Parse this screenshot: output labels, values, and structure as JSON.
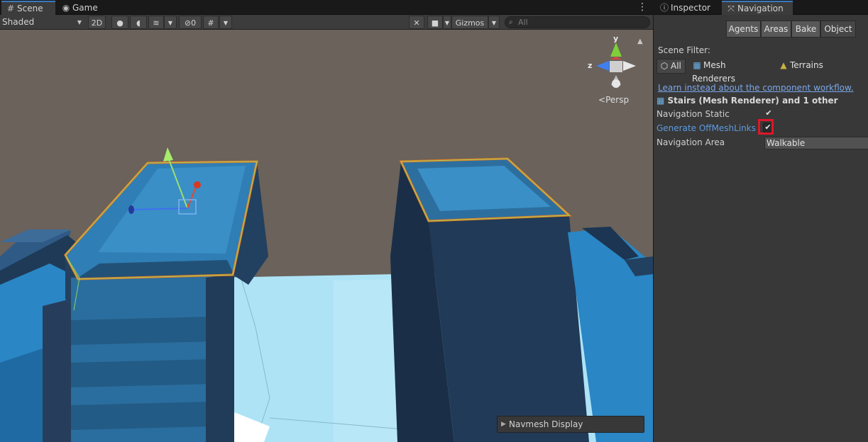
{
  "scene_window": {
    "tabs": [
      {
        "label": "Scene",
        "icon": "hash-grid-icon"
      },
      {
        "label": "Game",
        "icon": "gamepad-icon"
      }
    ],
    "toolbar": {
      "shading_mode": "Shaded",
      "toggle_2d": "2D",
      "hidden_count": "0",
      "gizmos_label": "Gizmos",
      "search_placeholder": "All"
    },
    "orientation_gizmo": {
      "y_label": "y",
      "z_label": "z",
      "projection": "Persp"
    },
    "overlay": {
      "navmesh_display": "Navmesh Display"
    }
  },
  "nav_window": {
    "tabs": [
      {
        "label": "Inspector",
        "icon": "info-icon"
      },
      {
        "label": "Navigation",
        "icon": "navigation-icon"
      }
    ],
    "modes": [
      "Agents",
      "Areas",
      "Bake",
      "Object"
    ],
    "selected_mode": "Object",
    "scene_filter": {
      "label": "Scene Filter:",
      "options": [
        "All",
        "Mesh Renderers",
        "Terrains"
      ],
      "selected": "All"
    },
    "workflow_link": "Learn instead about the component workflow.",
    "object_title": "Stairs (Mesh Renderer) and 1 other",
    "fields": {
      "navigation_static": {
        "label": "Navigation Static",
        "checked": true
      },
      "generate_offmeshlinks": {
        "label": "Generate OffMeshLinks",
        "checked": true
      },
      "navigation_area": {
        "label": "Navigation Area",
        "value": "Walkable"
      }
    }
  },
  "colors": {
    "accent_tab": "#3a79bb",
    "highlight_box": "#e0162a",
    "selection_outline": "#f07a1a",
    "link": "#7aa8ea"
  }
}
